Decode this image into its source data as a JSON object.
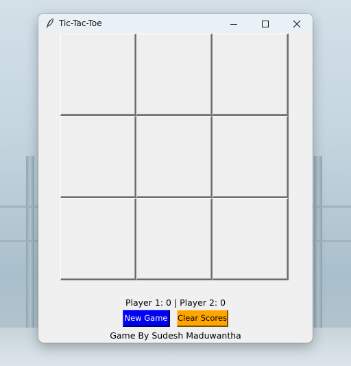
{
  "window": {
    "title": "Tic-Tac-Toe",
    "icon": "feather-icon",
    "controls": {
      "minimize_icon": "minimize-icon",
      "maximize_icon": "maximize-icon",
      "close_icon": "close-icon"
    }
  },
  "board": {
    "cells": [
      "",
      "",
      "",
      "",
      "",
      "",
      "",
      "",
      ""
    ]
  },
  "scoreboard": {
    "text": "Player 1: 0 | Player 2: 0"
  },
  "buttons": {
    "new_game": {
      "label": "New Game",
      "color": "#0000f0"
    },
    "clear_scores": {
      "label": "Clear Scores",
      "color": "#ffa500"
    }
  },
  "footer": {
    "credit": "Game By Sudesh Maduwantha"
  }
}
